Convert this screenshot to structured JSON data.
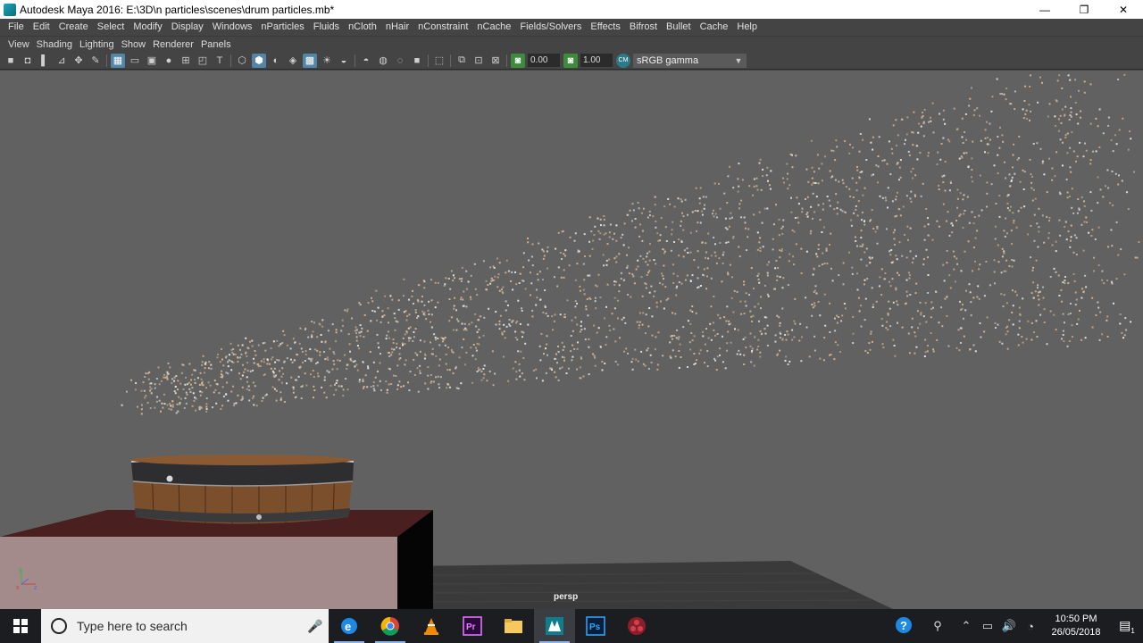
{
  "window": {
    "title": "Autodesk Maya 2016: E:\\3D\\n particles\\scenes\\drum particles.mb*",
    "minimize": "—",
    "restore": "❐",
    "close": "✕"
  },
  "menubar": {
    "items": [
      "File",
      "Edit",
      "Create",
      "Select",
      "Modify",
      "Display",
      "Windows",
      "nParticles",
      "Fluids",
      "nCloth",
      "nHair",
      "nConstraint",
      "nCache",
      "Fields/Solvers",
      "Effects",
      "Bifrost",
      "Bullet",
      "Cache",
      "Help"
    ]
  },
  "panel_menu": {
    "items": [
      "View",
      "Shading",
      "Lighting",
      "Show",
      "Renderer",
      "Panels"
    ]
  },
  "toolbar": {
    "exposure": "0.00",
    "gamma": "1.00",
    "color_space": "sRGB gamma"
  },
  "viewport": {
    "camera_label": "persp",
    "background": "#616161",
    "particle_color_warm": "#d8b48e",
    "particle_color_cool": "#e6e6e6"
  },
  "taskbar": {
    "search_placeholder": "Type here to search",
    "clock_time": "10:50 PM",
    "clock_date": "26/05/2018",
    "notification_count": "1"
  }
}
